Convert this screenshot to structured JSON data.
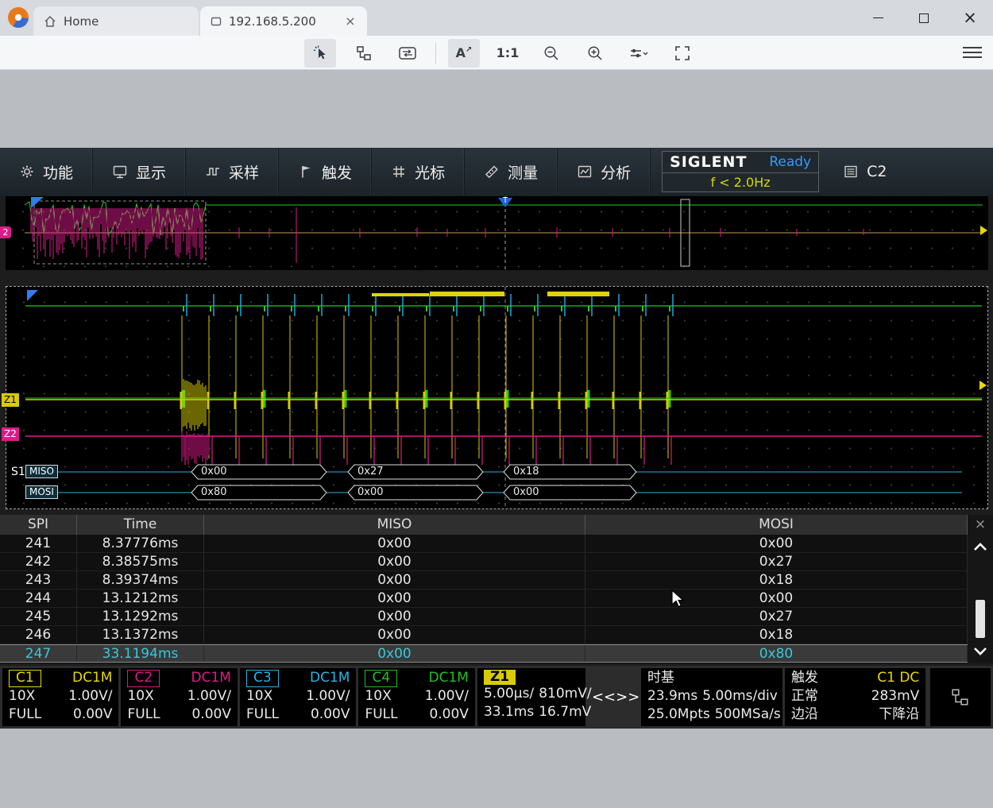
{
  "browser": {
    "tabs": [
      {
        "label": "Home"
      },
      {
        "label": "192.168.5.200"
      }
    ],
    "toolbar": {
      "fontsize_label": "A",
      "fontsize_arrow": "↗",
      "scale_label": "1:1"
    }
  },
  "menubar": {
    "items": [
      {
        "label": "功能"
      },
      {
        "label": "显示"
      },
      {
        "label": "采样"
      },
      {
        "label": "触发"
      },
      {
        "label": "光标"
      },
      {
        "label": "测量"
      },
      {
        "label": "分析"
      }
    ],
    "brand": "SIGLENT",
    "acq_status": "Ready",
    "trig_freq": "f < 2.0Hz",
    "active_channel": "C2"
  },
  "overview": {
    "trigger_label": "T",
    "channel_marker": "2"
  },
  "zoomview": {
    "z1_marker": "Z1",
    "z2_marker": "Z2",
    "bus_name": "S1",
    "miso_label": "MISO",
    "mosi_label": "MOSI",
    "miso_values": [
      "0x00",
      "0x27",
      "0x18"
    ],
    "mosi_values": [
      "0x80",
      "0x00",
      "0x00"
    ]
  },
  "decode_table": {
    "headers": [
      "SPI",
      "Time",
      "MISO",
      "MOSI"
    ],
    "rows": [
      {
        "idx": "241",
        "time": "8.37776ms",
        "miso": "0x00",
        "mosi": "0x00"
      },
      {
        "idx": "242",
        "time": "8.38575ms",
        "miso": "0x00",
        "mosi": "0x27"
      },
      {
        "idx": "243",
        "time": "8.39374ms",
        "miso": "0x00",
        "mosi": "0x18"
      },
      {
        "idx": "244",
        "time": "13.1212ms",
        "miso": "0x00",
        "mosi": "0x00"
      },
      {
        "idx": "245",
        "time": "13.1292ms",
        "miso": "0x00",
        "mosi": "0x27"
      },
      {
        "idx": "246",
        "time": "13.1372ms",
        "miso": "0x00",
        "mosi": "0x18"
      },
      {
        "idx": "247",
        "time": "33.1194ms",
        "miso": "0x00",
        "mosi": "0x80"
      }
    ]
  },
  "channels": [
    {
      "name": "C1",
      "coupling": "DC1M",
      "atten": "10X",
      "scale": "1.00V/",
      "bw": "FULL",
      "offset": "0.00V",
      "color": "#e8d800"
    },
    {
      "name": "C2",
      "coupling": "DC1M",
      "atten": "10X",
      "scale": "1.00V/",
      "bw": "FULL",
      "offset": "0.00V",
      "color": "#e0188c"
    },
    {
      "name": "C3",
      "coupling": "DC1M",
      "atten": "10X",
      "scale": "1.00V/",
      "bw": "FULL",
      "offset": "0.00V",
      "color": "#28b4e8"
    },
    {
      "name": "C4",
      "coupling": "DC1M",
      "atten": "10X",
      "scale": "1.00V/",
      "bw": "FULL",
      "offset": "0.00V",
      "color": "#22c022"
    }
  ],
  "zoom_box": {
    "name": "Z1",
    "hscale": "5.00µs/",
    "vscale": "810mV/",
    "hpos": "33.1ms",
    "voffset": "16.7mV",
    "nav_prev": "<<",
    "nav_next": ">>"
  },
  "timebase": {
    "title": "时基",
    "delay": "23.9ms",
    "scale": "5.00ms/div",
    "mem": "25.0Mpts",
    "rate": "500MSa/s"
  },
  "trigger": {
    "title": "触发",
    "source_coupling": "C1 DC",
    "mode": "正常",
    "level": "283mV",
    "type": "边沿",
    "slope": "下降沿"
  }
}
